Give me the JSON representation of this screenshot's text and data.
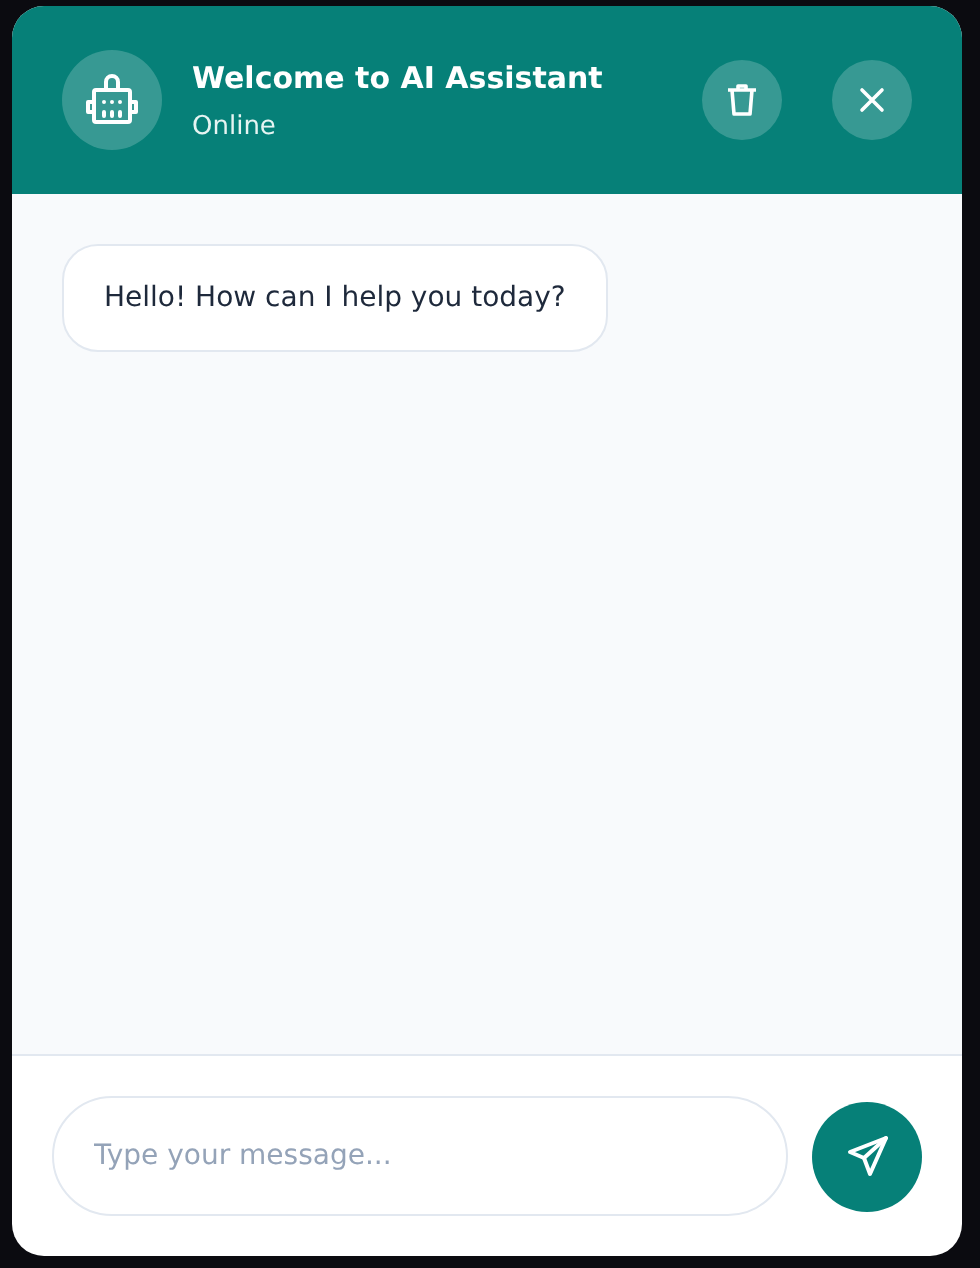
{
  "header": {
    "title": "Welcome to AI Assistant",
    "status": "Online"
  },
  "messages": [
    {
      "kind": "incoming",
      "text": "Hello! How can I help you today?"
    }
  ],
  "composer": {
    "placeholder": "Type your message..."
  }
}
